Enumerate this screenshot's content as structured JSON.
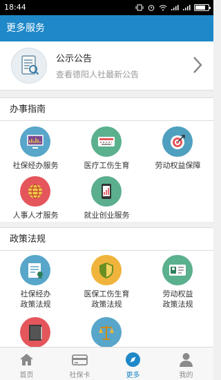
{
  "status": {
    "time": "18:44"
  },
  "header": {
    "title": "更多服务"
  },
  "notice": {
    "title": "公示公告",
    "subtitle": "查看德阳人社最新公告"
  },
  "sections": [
    {
      "title": "办事指南",
      "items": [
        {
          "label": "社保经办服务",
          "icon": "monitor-icon",
          "color": "#58a6c9"
        },
        {
          "label": "医疗工伤生育",
          "icon": "keyboard-icon",
          "color": "#5bb08e"
        },
        {
          "label": "劳动权益保障",
          "icon": "target-icon",
          "color": "#4f9fbf"
        },
        {
          "label": "人事人才服务",
          "icon": "globe-icon",
          "color": "#e4565b"
        },
        {
          "label": "就业创业服务",
          "icon": "phone-chart-icon",
          "color": "#5bae8e"
        }
      ]
    },
    {
      "title": "政策法规",
      "items": [
        {
          "label": "社保经办",
          "label2": "政策法规",
          "icon": "certificate-icon",
          "color": "#58a6c9"
        },
        {
          "label": "医保工伤生育",
          "label2": "政策法规",
          "icon": "shield-icon",
          "color": "#f0b43c"
        },
        {
          "label": "劳动权益",
          "label2": "政策法规",
          "icon": "id-card-icon",
          "color": "#5bb08e"
        },
        {
          "label": "",
          "icon": "book-icon",
          "color": "#e4565b"
        },
        {
          "label": "",
          "icon": "scales-icon",
          "color": "#58a6c9"
        }
      ]
    }
  ],
  "tabs": [
    {
      "label": "首页",
      "icon": "home-icon"
    },
    {
      "label": "社保卡",
      "icon": "card-icon"
    },
    {
      "label": "更多",
      "icon": "compass-icon",
      "active": true
    },
    {
      "label": "我的",
      "icon": "user-icon"
    }
  ]
}
